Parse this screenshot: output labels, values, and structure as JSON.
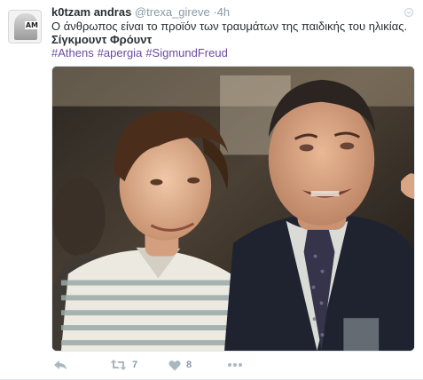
{
  "tweet": {
    "author_name": "k0tzam andras",
    "author_handle": "@trexa_gireve",
    "separator": "·",
    "time": "4h",
    "avatar_text": "AM",
    "text_line_1": "Ο άνθρωπος είναι το προϊόν των τραυμάτων της παιδικής του ηλικίας.",
    "text_line_2": "Σίγκμουντ Φρόυντ",
    "hashtags": [
      "#Athens",
      "#apergia",
      "#SigmundFreud"
    ],
    "media": {
      "type": "photo",
      "description_icon": "photo"
    },
    "actions": {
      "reply_icon": "reply-icon",
      "retweet_icon": "retweet-icon",
      "retweet_count": "7",
      "like_icon": "heart-icon",
      "like_count": "8",
      "more_icon": "more-icon"
    }
  },
  "colors": {
    "text": "#292f33",
    "meta": "#8899a6",
    "hashtag": "#6b4aa1",
    "action_icon": "#aab8c2"
  }
}
